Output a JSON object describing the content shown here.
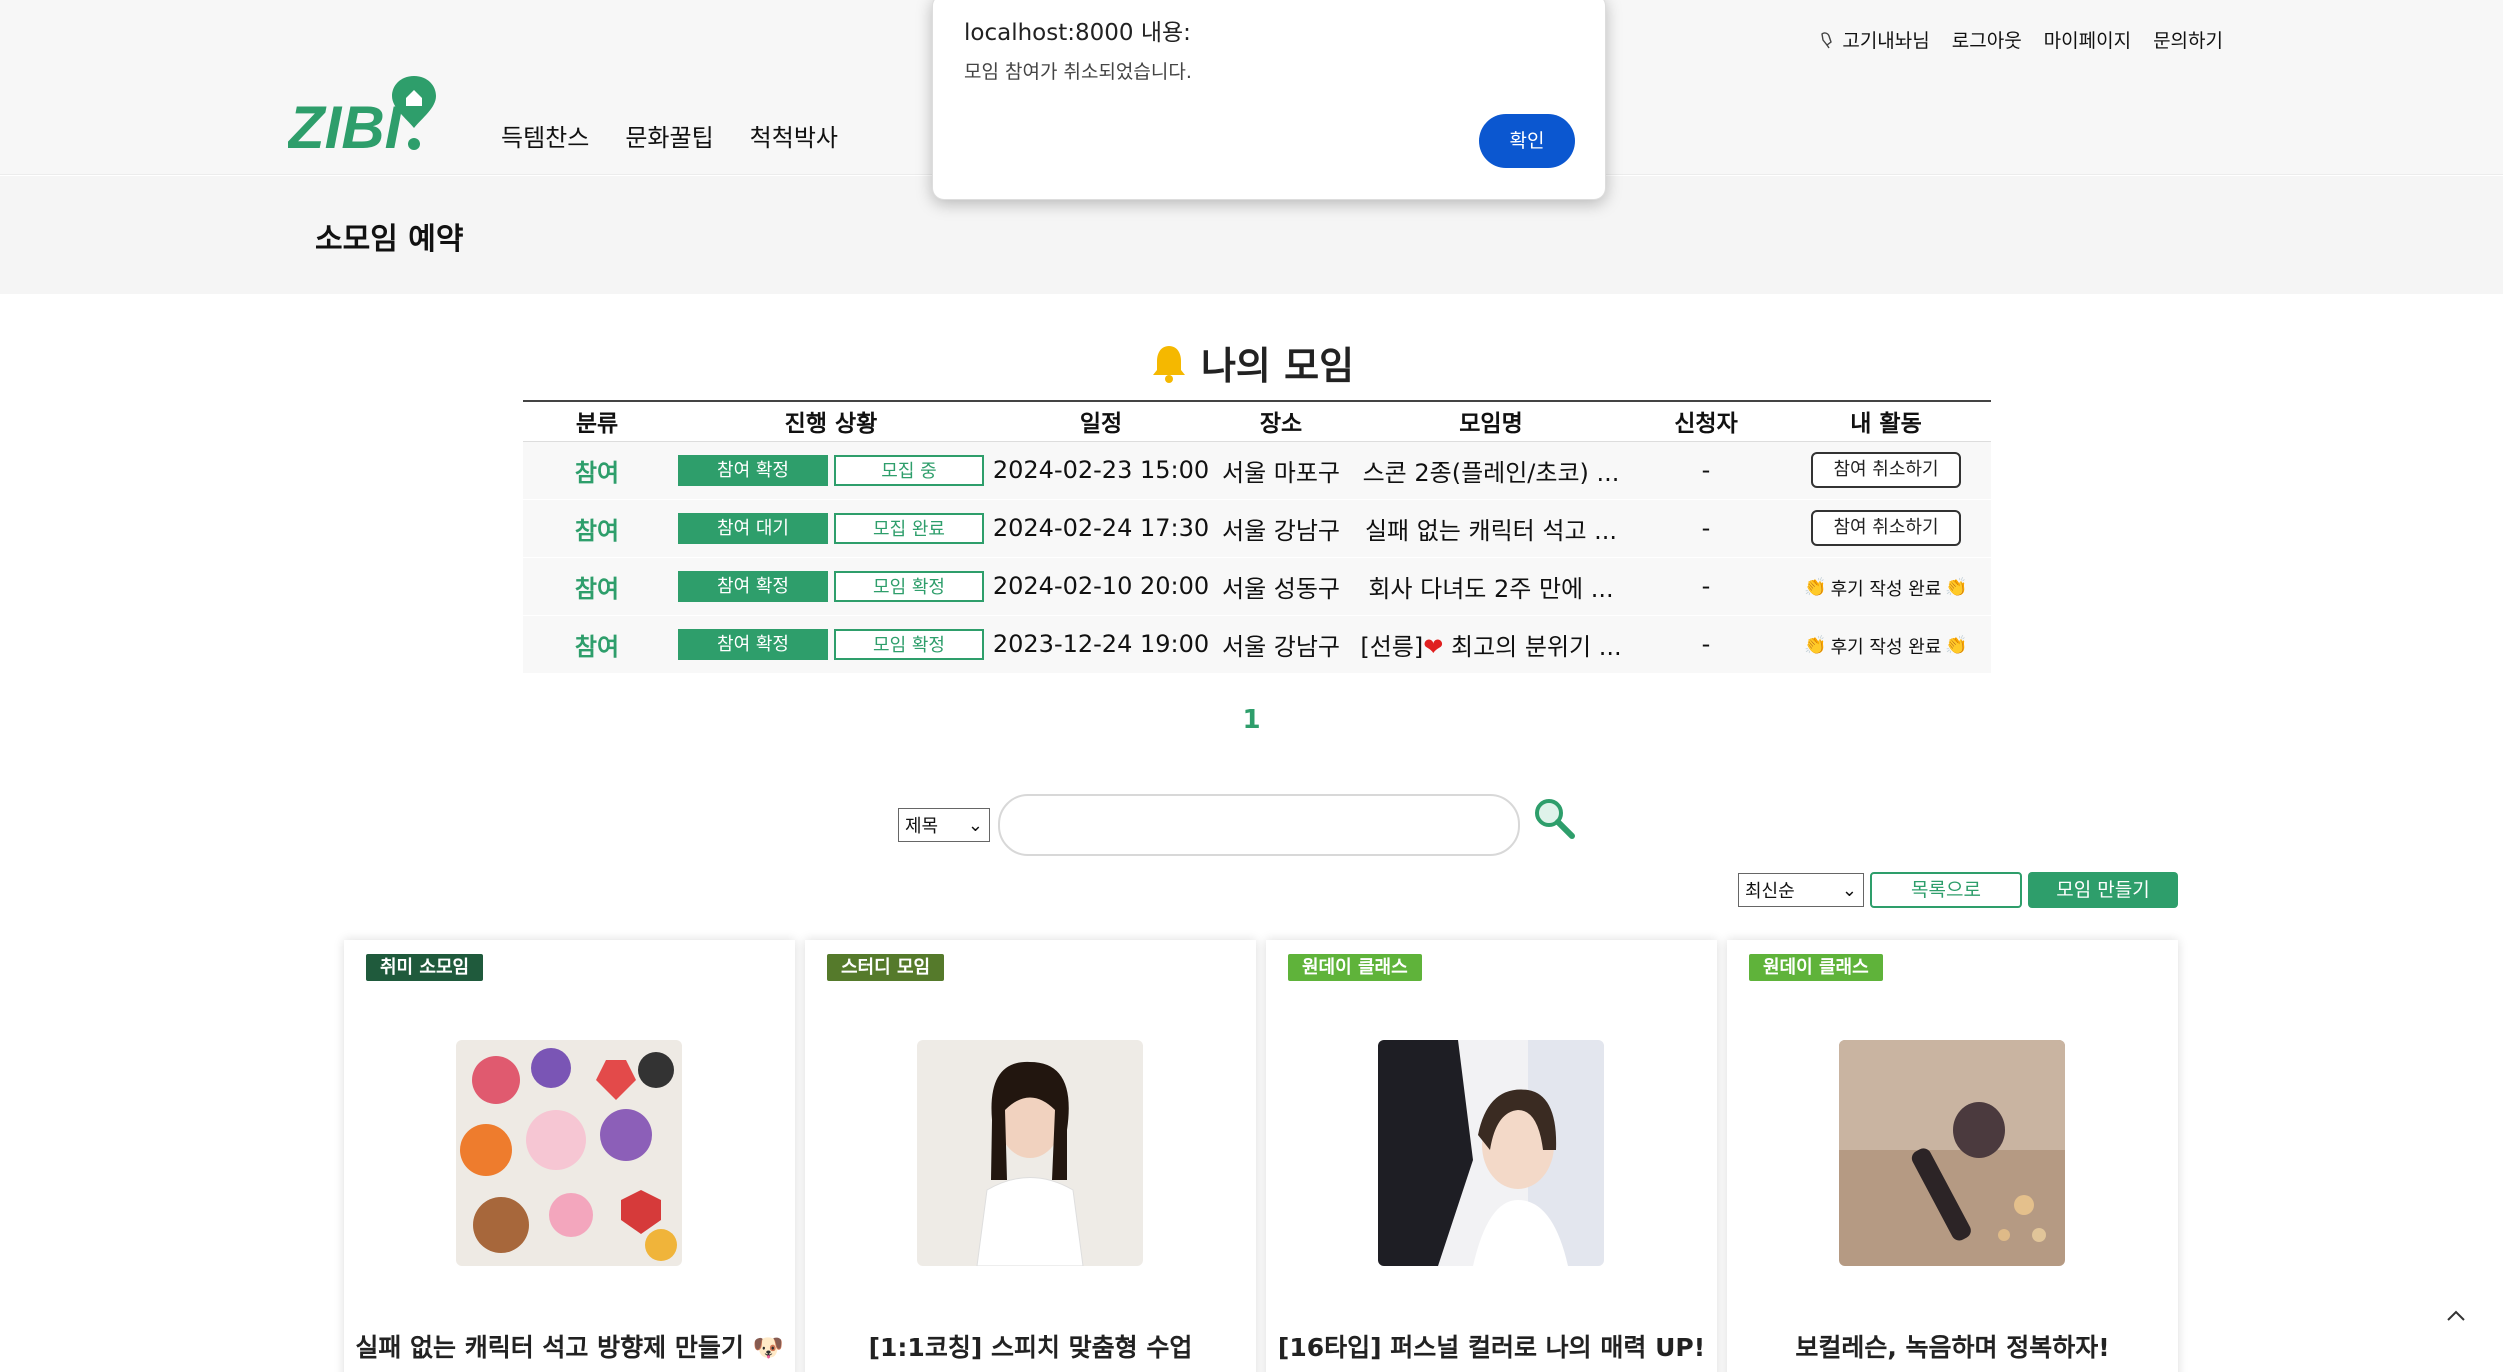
{
  "header": {
    "nav": [
      "득템찬스",
      "문화꿀팁",
      "척척박사"
    ],
    "user_name": "고기내놔님",
    "logout": "로그아웃",
    "mypage": "마이페이지",
    "inquiry": "문의하기"
  },
  "subheader": {
    "title": "소모임 예약"
  },
  "my_meetings": {
    "title": "나의 모임",
    "columns": [
      "분류",
      "진행 상황",
      "일정",
      "장소",
      "모임명",
      "신청자",
      "내 활동"
    ],
    "rows": [
      {
        "category": "참여",
        "status_primary": "참여 확정",
        "status_secondary": "모집 중",
        "schedule": "2024-02-23 15:00",
        "place": "서울 마포구",
        "name": "스콘 2종(플레인/초코) ...",
        "applicant": "-",
        "action": "참여 취소하기",
        "action_type": "button"
      },
      {
        "category": "참여",
        "status_primary": "참여 대기",
        "status_secondary": "모집 완료",
        "schedule": "2024-02-24 17:30",
        "place": "서울 강남구",
        "name": "실패 없는 캐릭터 석고 ...",
        "applicant": "-",
        "action": "참여 취소하기",
        "action_type": "button"
      },
      {
        "category": "참여",
        "status_primary": "참여 확정",
        "status_secondary": "모임 확정",
        "schedule": "2024-02-10 20:00",
        "place": "서울 성동구",
        "name": "회사 다녀도 2주 만에 ...",
        "applicant": "-",
        "action": "후기 작성 완료",
        "action_type": "done"
      },
      {
        "category": "참여",
        "status_primary": "참여 확정",
        "status_secondary": "모임 확정",
        "schedule": "2023-12-24 19:00",
        "place": "서울 강남구",
        "name_prefix": "[선릉]",
        "name": "최고의 분위기 ...",
        "applicant": "-",
        "action": "후기 작성 완료",
        "action_type": "done"
      }
    ],
    "page": "1"
  },
  "search": {
    "field_select": "제목",
    "placeholder": ""
  },
  "list_tools": {
    "sort": "최신순",
    "back_to_list": "목록으로",
    "create": "모임 만들기"
  },
  "cards": [
    {
      "tag": "취미 소모임",
      "tag_color": "#1f5a3c",
      "title": "실패 없는 캐릭터 석고 방향제 만들기 🐶"
    },
    {
      "tag": "스터디 모임",
      "tag_color": "#557a2b",
      "title": "[1:1코칭] 스피치 맞춤형 수업"
    },
    {
      "tag": "원데이 클래스",
      "tag_color": "#5fb33a",
      "title": "[16타입] 퍼스널 컬러로 나의 매력 UP!"
    },
    {
      "tag": "원데이 클래스",
      "tag_color": "#5fb33a",
      "title": "보컬레슨, 녹음하며 정복하자!"
    }
  ],
  "dialog": {
    "title": "localhost:8000 내용:",
    "message": "모임 참여가 취소되었습니다.",
    "ok": "확인"
  },
  "colors": {
    "brand": "#2e9e6b",
    "dialog_button": "#0b57d0"
  }
}
